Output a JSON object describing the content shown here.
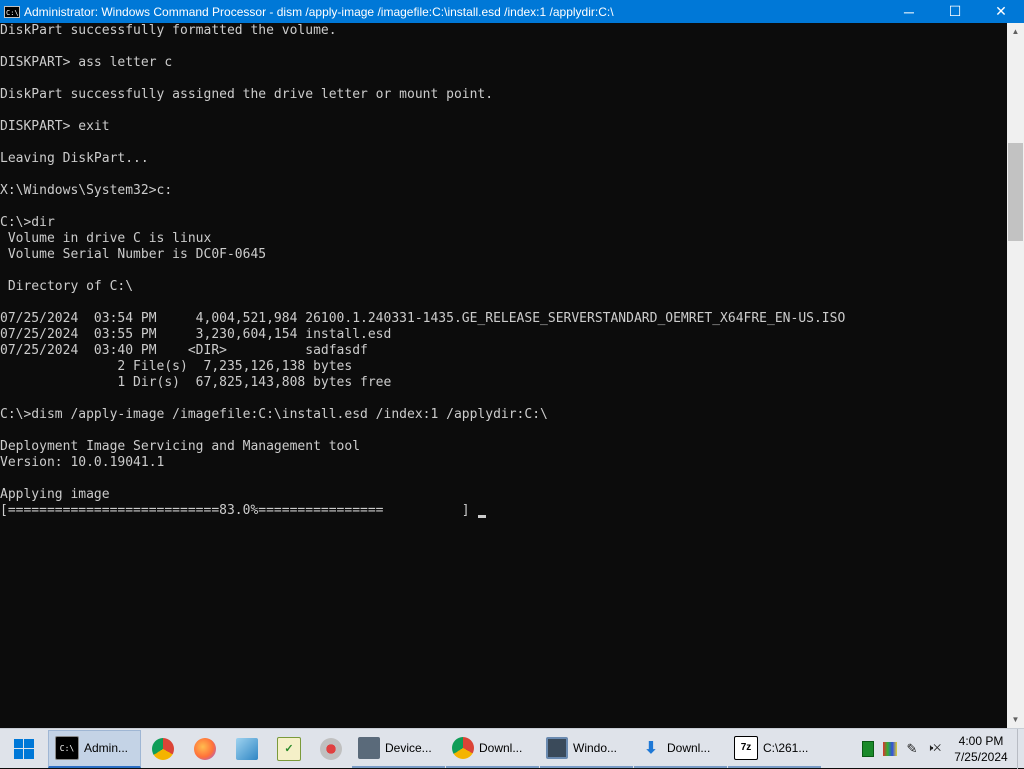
{
  "window": {
    "title": "Administrator: Windows Command Processor - dism  /apply-image /imagefile:C:\\install.esd /index:1 /applydir:C:\\",
    "icon": "cmd-icon",
    "icon_text": "C:\\",
    "controls": {
      "minimize": "─",
      "maximize": "☐",
      "close": "✕"
    }
  },
  "console": {
    "lines": [
      "DiskPart successfully formatted the volume.",
      "",
      "DISKPART> ass letter c",
      "",
      "DiskPart successfully assigned the drive letter or mount point.",
      "",
      "DISKPART> exit",
      "",
      "Leaving DiskPart...",
      "",
      "X:\\Windows\\System32>c:",
      "",
      "C:\\>dir",
      " Volume in drive C is linux",
      " Volume Serial Number is DC0F-0645",
      "",
      " Directory of C:\\",
      "",
      "07/25/2024  03:54 PM     4,004,521,984 26100.1.240331-1435.GE_RELEASE_SERVERSTANDARD_OEMRET_X64FRE_EN-US.ISO",
      "07/25/2024  03:55 PM     3,230,604,154 install.esd",
      "07/25/2024  03:40 PM    <DIR>          sadfasdf",
      "               2 File(s)  7,235,126,138 bytes",
      "               1 Dir(s)  67,825,143,808 bytes free",
      "",
      "C:\\>dism /apply-image /imagefile:C:\\install.esd /index:1 /applydir:C:\\",
      "",
      "Deployment Image Servicing and Management tool",
      "Version: 10.0.19041.1",
      "",
      "Applying image"
    ],
    "progress_line": "[===========================83.0%================          ]",
    "progress_percent": 83.0
  },
  "taskbar": {
    "start_icon": "windows-logo-icon",
    "buttons": [
      {
        "name": "taskbar-cmd",
        "label": "Admin...",
        "icon": "cmd-icon",
        "icon_text": "C:\\",
        "active": true
      },
      {
        "name": "taskbar-chrome",
        "label": "",
        "icon": "chrome-icon"
      },
      {
        "name": "taskbar-firefox",
        "label": "",
        "icon": "firefox-icon"
      },
      {
        "name": "taskbar-app-3",
        "label": "",
        "icon": "window-app-icon"
      },
      {
        "name": "taskbar-app-4",
        "label": "",
        "icon": "notepad-check-icon"
      },
      {
        "name": "taskbar-app-5",
        "label": "",
        "icon": "paint-icon"
      },
      {
        "name": "taskbar-device",
        "label": "Device...",
        "icon": "device-manager-icon"
      },
      {
        "name": "taskbar-downloads-chrome",
        "label": "Downl...",
        "icon": "chrome-icon"
      },
      {
        "name": "taskbar-windows",
        "label": "Windo...",
        "icon": "monitor-icon"
      },
      {
        "name": "taskbar-downloads",
        "label": "Downl...",
        "icon": "download-icon"
      },
      {
        "name": "taskbar-7zip",
        "label": "C:\\261...",
        "icon": "7zip-icon",
        "icon_text": "7z"
      }
    ],
    "tray": [
      {
        "name": "green-app-icon"
      },
      {
        "name": "color-app-icon"
      },
      {
        "name": "pen-icon"
      },
      {
        "name": "volume-muted-icon"
      }
    ],
    "clock": {
      "time": "4:00 PM",
      "date": "7/25/2024"
    }
  },
  "colors": {
    "titlebar": "#0078d7",
    "console_bg": "#0c0c0c",
    "console_text": "#cccccc",
    "taskbar": "#dfe3ea"
  }
}
